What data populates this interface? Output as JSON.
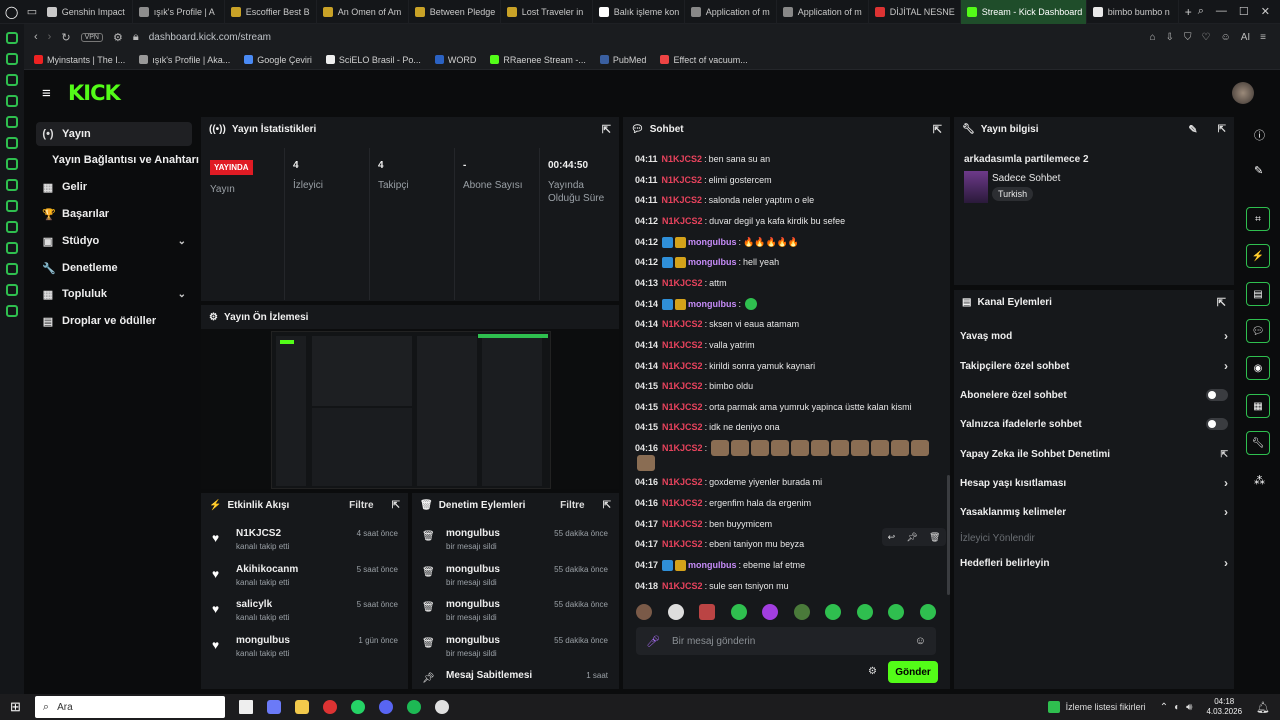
{
  "browser": {
    "tabs": [
      {
        "label": "Genshin Impact",
        "color": "#c9c9c9"
      },
      {
        "label": "ışık's Profile | A",
        "color": "#8d8d8d"
      },
      {
        "label": "Escoffier Best B",
        "color": "#c9a227"
      },
      {
        "label": "An Omen of Am",
        "color": "#c9a227"
      },
      {
        "label": "Between Pledge",
        "color": "#c9a227"
      },
      {
        "label": "Lost Traveler in",
        "color": "#c9a227"
      },
      {
        "label": "Balık işleme kon",
        "color": "#ffffff"
      },
      {
        "label": "Application of m",
        "color": "#888888"
      },
      {
        "label": "Application of m",
        "color": "#888888"
      },
      {
        "label": "DİJİTAL NESNE",
        "color": "#d33"
      },
      {
        "label": "Stream - Kick Dashboard",
        "color": "#53fc18",
        "active": true
      },
      {
        "label": "bimbo bumbo n",
        "color": "#e9e9e9"
      }
    ],
    "url": "dashboard.kick.com/stream",
    "vpn": "VPN",
    "bookmarks": [
      {
        "label": "Myinstants | The I...",
        "color": "#e22"
      },
      {
        "label": "ışık's Profile | Aka...",
        "color": "#999"
      },
      {
        "label": "Google Çeviri",
        "color": "#4a8af4"
      },
      {
        "label": "SciELO Brasil - Po...",
        "color": "#eee"
      },
      {
        "label": "WORD",
        "color": "#2b62c3"
      },
      {
        "label": "RRaenee Stream -...",
        "color": "#53fc18"
      },
      {
        "label": "PubMed",
        "color": "#3a5fa0"
      },
      {
        "label": "Effect of vacuum...",
        "color": "#e44"
      }
    ]
  },
  "nav": {
    "items": [
      {
        "label": "Yayın",
        "icon": "(•)"
      },
      {
        "label": "Yayın Bağlantısı ve Anahtarı",
        "icon": ""
      },
      {
        "label": "Gelir",
        "icon": "▦"
      },
      {
        "label": "Başarılar",
        "icon": "🏆"
      },
      {
        "label": "Stüdyo",
        "icon": "▣"
      },
      {
        "label": "Denetleme",
        "icon": "🔧"
      },
      {
        "label": "Topluluk",
        "icon": "▦"
      },
      {
        "label": "Droplar ve ödüller",
        "icon": "▤"
      }
    ]
  },
  "stats": {
    "title": "Yayın İstatistikleri",
    "live": "YAYINDA",
    "live_label": "Yayın",
    "viewers": "4",
    "viewers_label": "İzleyici",
    "followers": "4",
    "followers_label": "Takipçi",
    "subs": "-",
    "subs_label": "Abone Sayısı",
    "uptime": "00:44:50",
    "uptime_label": "Yayında Olduğu Süre"
  },
  "preview": {
    "title": "Yayın Ön İzlemesi"
  },
  "activity": {
    "title": "Etkinlik Akışı",
    "filter": "Filtre",
    "items": [
      {
        "name": "N1KJCS2",
        "sub": "kanalı takip etti",
        "time": "4 saat önce"
      },
      {
        "name": "Akihikocanm",
        "sub": "kanalı takip etti",
        "time": "5 saat önce"
      },
      {
        "name": "salicylk",
        "sub": "kanalı takip etti",
        "time": "5 saat önce"
      },
      {
        "name": "mongulbus",
        "sub": "kanalı takip etti",
        "time": "1 gün önce"
      }
    ]
  },
  "mod": {
    "title": "Denetim Eylemleri",
    "filter": "Filtre",
    "items": [
      {
        "name": "mongulbus",
        "sub": "bir mesajı sildi",
        "time": "55 dakika önce"
      },
      {
        "name": "mongulbus",
        "sub": "bir mesajı sildi",
        "time": "55 dakika önce"
      },
      {
        "name": "mongulbus",
        "sub": "bir mesajı sildi",
        "time": "55 dakika önce"
      },
      {
        "name": "mongulbus",
        "sub": "bir mesajı sildi",
        "time": "55 dakika önce"
      },
      {
        "name": "Mesaj Sabitlemesi",
        "sub": "",
        "time": "1 saat"
      }
    ]
  },
  "chat": {
    "title": "Sohbet",
    "placeholder": "Bir mesaj gönderin",
    "send": "Gönder",
    "messages": [
      {
        "t": "04:11",
        "u": "N1KJCS2",
        "m": "ben sana su an"
      },
      {
        "t": "04:11",
        "u": "N1KJCS2",
        "m": "elimi gostercem"
      },
      {
        "t": "04:11",
        "u": "N1KJCS2",
        "m": "salonda neler yaptım o ele"
      },
      {
        "t": "04:12",
        "u": "N1KJCS2",
        "m": "duvar degil ya kafa kirdik bu sefee"
      },
      {
        "t": "04:12",
        "u": "mongulbus",
        "m": "🔥🔥🔥🔥🔥",
        "mod": true
      },
      {
        "t": "04:12",
        "u": "mongulbus",
        "m": "hell yeah",
        "mod": true
      },
      {
        "t": "04:13",
        "u": "N1KJCS2",
        "m": "attm"
      },
      {
        "t": "04:14",
        "u": "mongulbus",
        "m": "",
        "mod": true
      },
      {
        "t": "04:14",
        "u": "N1KJCS2",
        "m": "sksen vi eaua atamam"
      },
      {
        "t": "04:14",
        "u": "N1KJCS2",
        "m": "valla yatrim"
      },
      {
        "t": "04:14",
        "u": "N1KJCS2",
        "m": "kirildi sonra yamuk kaynari"
      },
      {
        "t": "04:15",
        "u": "N1KJCS2",
        "m": "bimbo oldu"
      },
      {
        "t": "04:15",
        "u": "N1KJCS2",
        "m": "orta parmak ama yumruk yapinca üstte kalan kismi"
      },
      {
        "t": "04:15",
        "u": "N1KJCS2",
        "m": "idk ne deniyo ona"
      },
      {
        "t": "04:16",
        "u": "N1KJCS2",
        "m": ""
      },
      {
        "t": "04:16",
        "u": "N1KJCS2",
        "m": "goxdeme yiyenler burada mi"
      },
      {
        "t": "04:16",
        "u": "N1KJCS2",
        "m": "ergenfim hala da ergenim"
      },
      {
        "t": "04:17",
        "u": "N1KJCS2",
        "m": "ben buyymicem"
      },
      {
        "t": "04:17",
        "u": "N1KJCS2",
        "m": "ebeni taniyon mu beyza"
      },
      {
        "t": "04:17",
        "u": "mongulbus",
        "m": "ebeme laf etme",
        "mod": true
      },
      {
        "t": "04:18",
        "u": "N1KJCS2",
        "m": "sule sen tsniyon mu"
      }
    ]
  },
  "info": {
    "title": "Yayın bilgisi",
    "stream_title": "arkadasımla partilemece 2",
    "category": "Sadece Sohbet",
    "tag": "Turkish"
  },
  "channel": {
    "title": "Kanal Eylemleri",
    "items": [
      {
        "label": "Yavaş mod",
        "kind": "arrow"
      },
      {
        "label": "Takipçilere özel sohbet",
        "kind": "arrow"
      },
      {
        "label": "Abonelere özel sohbet",
        "kind": "toggle"
      },
      {
        "label": "Yalnızca ifadelerle sohbet",
        "kind": "toggle"
      },
      {
        "label": "Yapay Zeka ile Sohbet Denetimi",
        "kind": "link"
      },
      {
        "label": "Hesap yaşı kısıtlaması",
        "kind": "arrow"
      },
      {
        "label": "Yasaklanmış kelimeler",
        "kind": "arrow"
      },
      {
        "label": "İzleyici Yönlendir",
        "kind": "disabled"
      },
      {
        "label": "Hedefleri belirleyin",
        "kind": "arrow"
      }
    ]
  },
  "taskbar": {
    "search": "Ara",
    "watch": "İzleme listesi fikirleri",
    "time": "04:18",
    "date": "4.03.2026"
  }
}
